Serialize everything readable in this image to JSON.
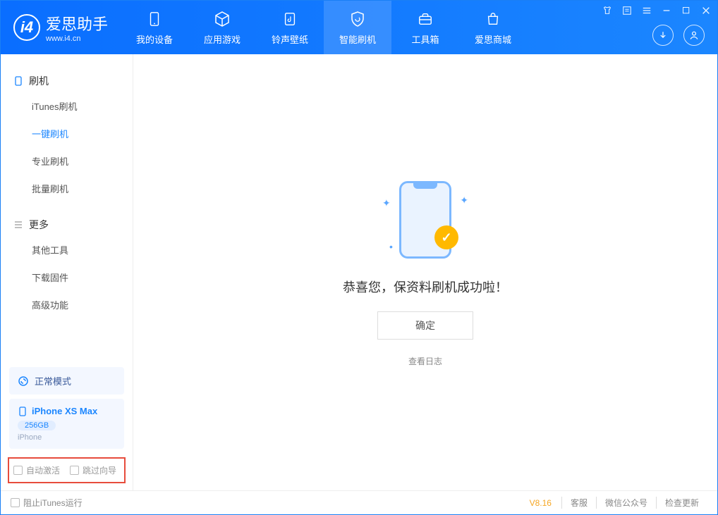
{
  "app": {
    "name": "爱思助手",
    "url": "www.i4.cn"
  },
  "tabs": {
    "device": "我的设备",
    "apps": "应用游戏",
    "ringtones": "铃声壁纸",
    "flash": "智能刷机",
    "toolbox": "工具箱",
    "store": "爱思商城"
  },
  "sidebar": {
    "flash_head": "刷机",
    "items": [
      "iTunes刷机",
      "一键刷机",
      "专业刷机",
      "批量刷机"
    ],
    "more_head": "更多",
    "more": [
      "其他工具",
      "下载固件",
      "高级功能"
    ]
  },
  "mode": {
    "label": "正常模式"
  },
  "device": {
    "name": "iPhone XS Max",
    "capacity": "256GB",
    "type": "iPhone"
  },
  "checks": {
    "auto_activate": "自动激活",
    "skip_guide": "跳过向导"
  },
  "main": {
    "message": "恭喜您，保资料刷机成功啦！",
    "ok": "确定",
    "viewlog": "查看日志"
  },
  "footer": {
    "block_itunes": "阻止iTunes运行",
    "version": "V8.16",
    "links": [
      "客服",
      "微信公众号",
      "检查更新"
    ]
  }
}
